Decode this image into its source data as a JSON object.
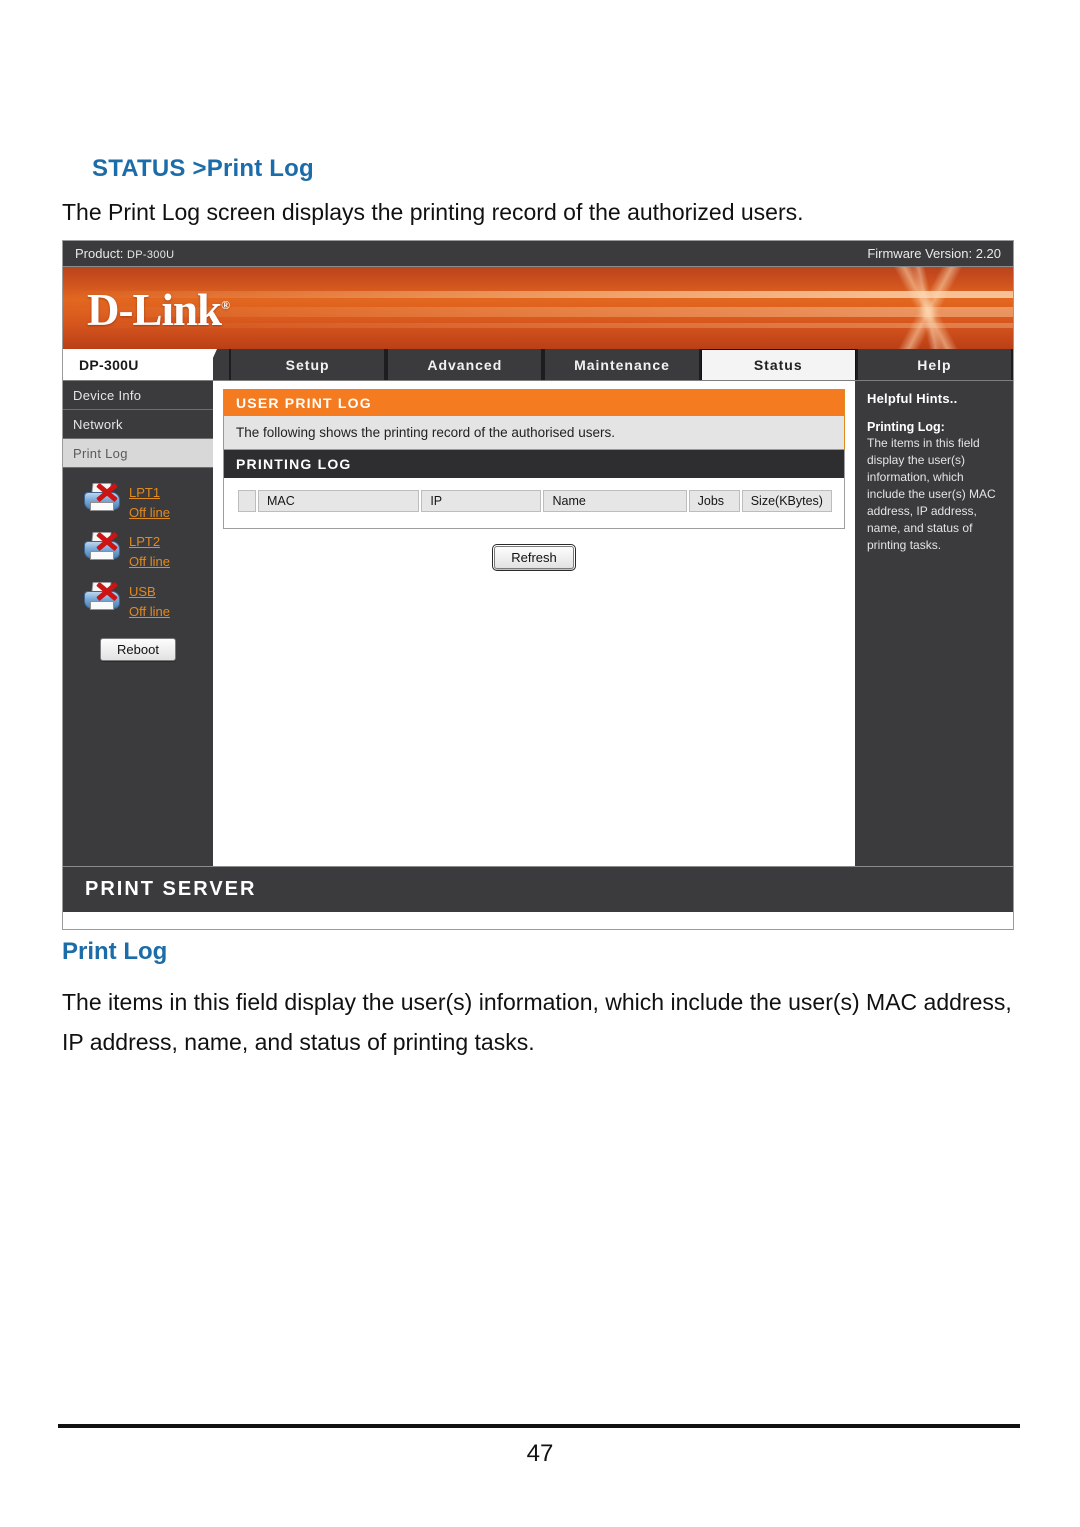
{
  "document": {
    "heading_prefix": "STATUS ",
    "heading_suffix": ">Print Log",
    "intro": "The Print Log screen displays the printing record of the authorized users.",
    "section_heading": "Print Log",
    "section_body": "The items in this field display the user(s) information, which include the user(s) MAC address, IP address, name, and status of printing tasks.",
    "page_number": "47"
  },
  "screenshot": {
    "product_bar": {
      "product_label": "Product:",
      "product_value": "DP-300U",
      "firmware_label": "Firmware Version:",
      "firmware_value": "2.20"
    },
    "brand": {
      "logo_text": "D-Link",
      "registered_mark": "®"
    },
    "nav": {
      "model_tab": "DP-300U",
      "items": [
        {
          "label": "Setup",
          "active": false
        },
        {
          "label": "Advanced",
          "active": false
        },
        {
          "label": "Maintenance",
          "active": false
        },
        {
          "label": "Status",
          "active": true
        },
        {
          "label": "Help",
          "active": false
        }
      ]
    },
    "sidebar": {
      "items": [
        {
          "label": "Device Info",
          "active": false
        },
        {
          "label": "Network",
          "active": false
        },
        {
          "label": "Print Log",
          "active": true
        }
      ],
      "printers": [
        {
          "port": "LPT1",
          "status": "Off line"
        },
        {
          "port": "LPT2",
          "status": "Off line"
        },
        {
          "port": "USB",
          "status": "Off line"
        }
      ],
      "reboot_label": "Reboot"
    },
    "main": {
      "panel_title": "USER PRINT LOG",
      "panel_description": "The following shows the printing record of the authorised users.",
      "log_title": "PRINTING LOG",
      "table": {
        "headers": [
          "",
          "MAC",
          "IP",
          "Name",
          "Jobs",
          "Size(KBytes)"
        ],
        "rows": []
      },
      "refresh_label": "Refresh"
    },
    "hints": {
      "title": "Helpful Hints..",
      "section_title": "Printing Log:",
      "body": "The items in this field display the user(s) information, which include the user(s) MAC address, IP address, name, and status of printing tasks."
    },
    "footer": {
      "label": "PRINT SERVER"
    }
  },
  "colors": {
    "heading_blue": "#1b6ca8",
    "panel_orange": "#f47b20",
    "dark_chrome": "#3b3b3e",
    "link_orange": "#e08a22",
    "banner_orange": "#c94d1e"
  }
}
